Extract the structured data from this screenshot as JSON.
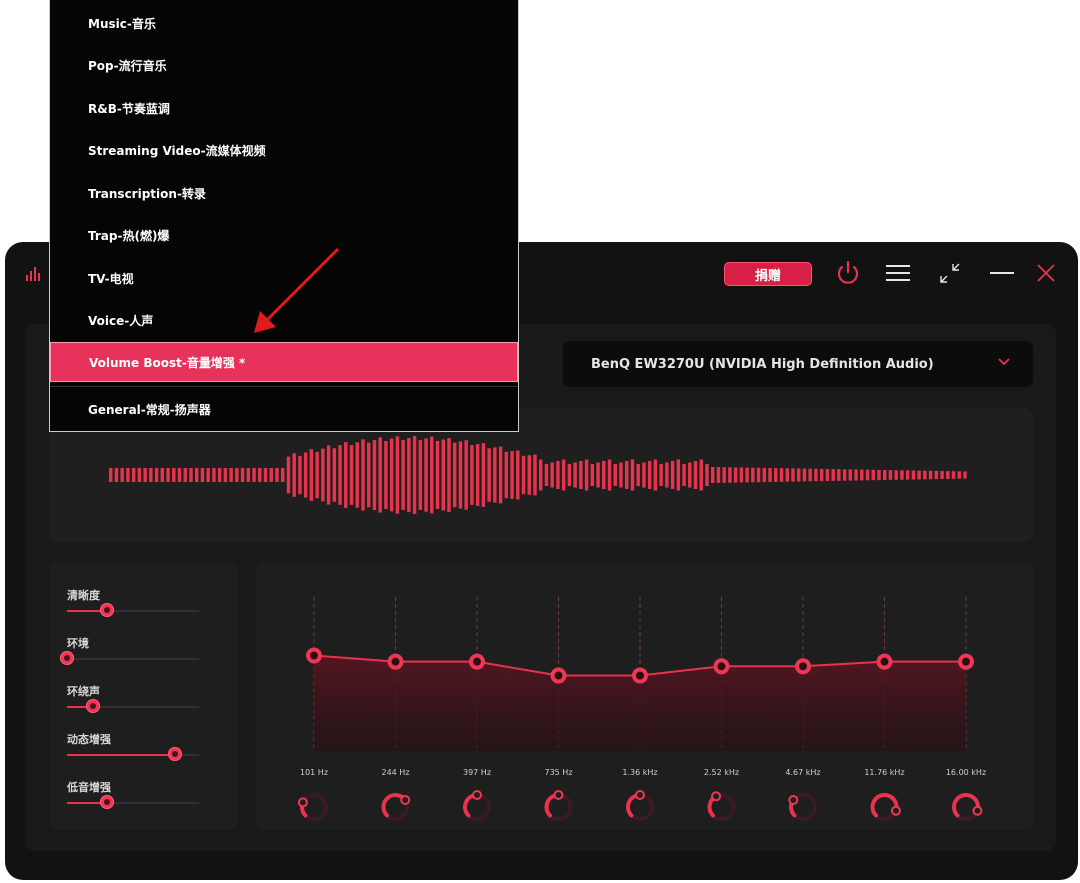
{
  "window": {
    "donate_label": "捐赠",
    "icons": [
      "equalizer-logo-icon",
      "power-icon",
      "hamburger-menu-icon",
      "minimize-to-compact-icon",
      "minimize-icon",
      "close-icon"
    ],
    "accent_color": "#e8334d"
  },
  "device": {
    "selected": "BenQ EW3270U (NVIDIA High Definition Audio)"
  },
  "preset_menu": {
    "items": [
      "Music-音乐",
      "Pop-流行音乐",
      "R&B-节奏蓝调",
      "Streaming Video-流媒体视频",
      "Transcription-转录",
      "Trap-热(燃)爆",
      "TV-电视",
      "Voice-人声",
      "Volume Boost-音量增强 *",
      "General-常规-扬声器"
    ],
    "selected_index": 8
  },
  "effects": [
    {
      "label": "清晰度",
      "level": 0.3
    },
    {
      "label": "环境",
      "level": 0.0
    },
    {
      "label": "环绕声",
      "level": 0.2
    },
    {
      "label": "动态增强",
      "level": 0.82
    },
    {
      "label": "低音增强",
      "level": 0.3
    }
  ],
  "equalizer": {
    "bands": [
      "101 Hz",
      "244 Hz",
      "397 Hz",
      "735 Hz",
      "1.36 kHz",
      "2.52 kHz",
      "4.67 kHz",
      "11.76 kHz",
      "16.00 kHz"
    ],
    "gain_levels": [
      0.62,
      0.58,
      0.58,
      0.49,
      0.49,
      0.55,
      0.55,
      0.58,
      0.58
    ],
    "q_levels": [
      0.25,
      0.7,
      0.5,
      0.5,
      0.5,
      0.4,
      0.3,
      0.9,
      0.9
    ]
  }
}
